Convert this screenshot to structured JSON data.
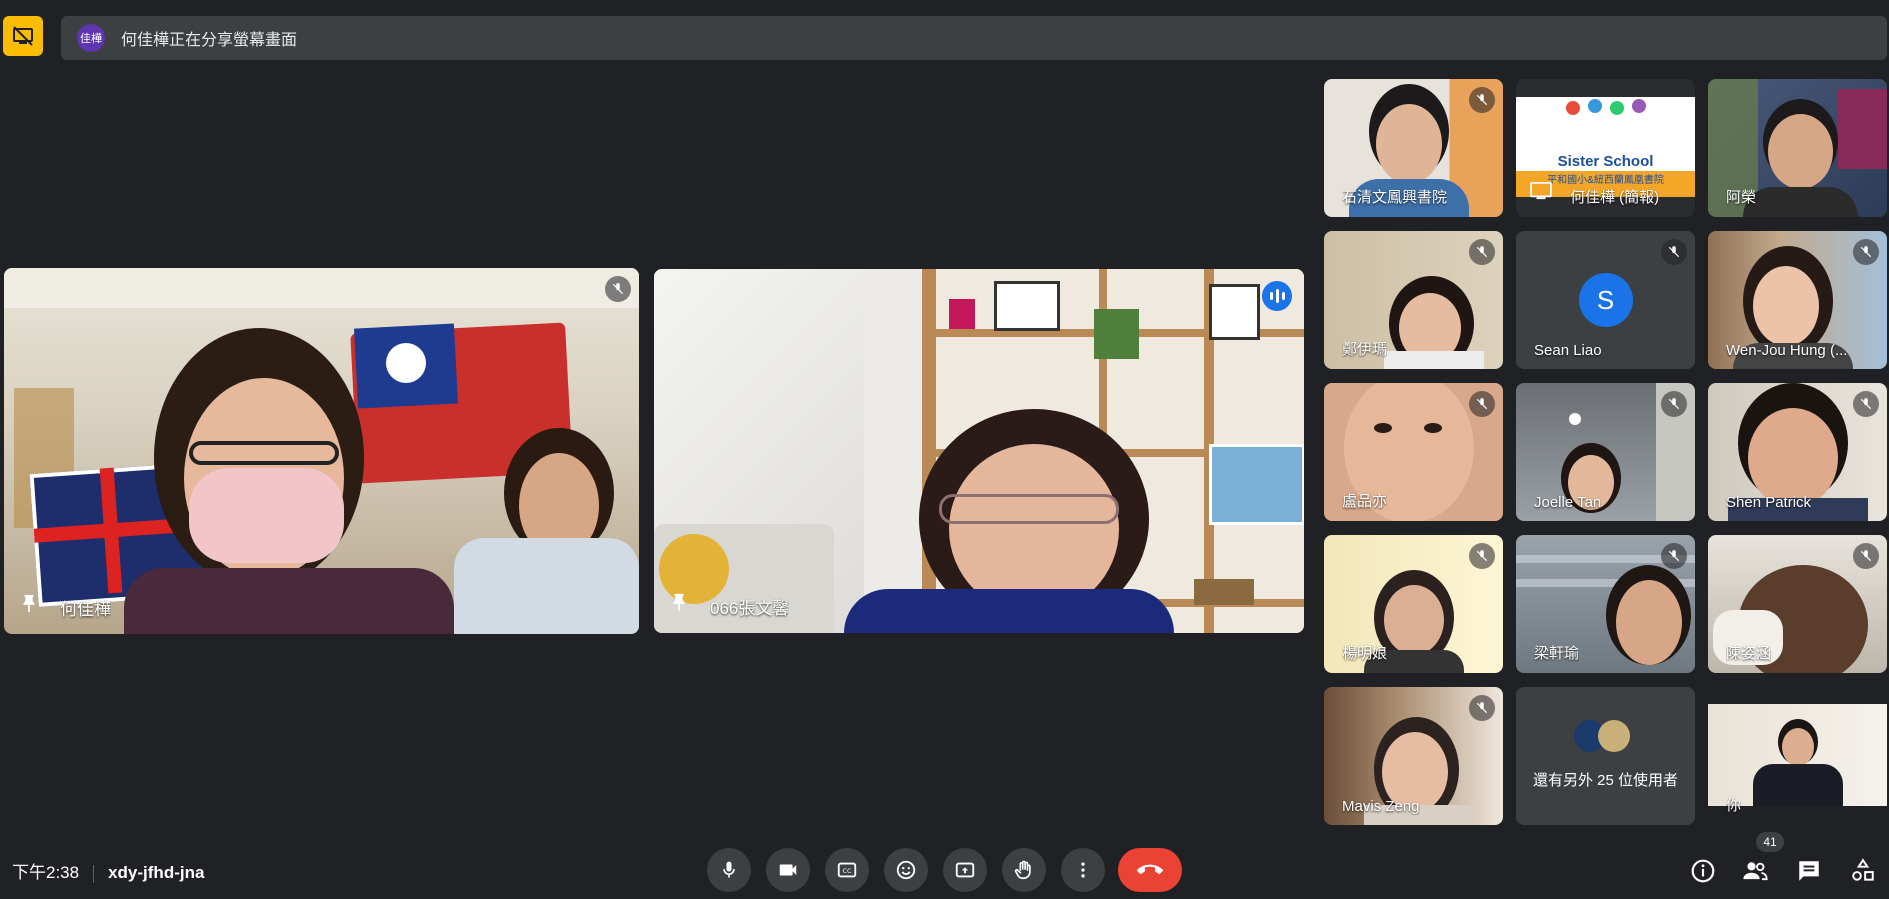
{
  "banner": {
    "avatar_label": "佳樺",
    "text": "何佳樺正在分享螢幕畫面"
  },
  "main_tiles": [
    {
      "name": "何佳樺"
    },
    {
      "name": "066張文馨"
    }
  ],
  "grid": [
    {
      "name": "石清文鳳興書院"
    },
    {
      "name": "何佳樺 (簡報)",
      "slide_title": "Sister School",
      "slide_sub": "平和國小&紐西蘭鳳凰書院"
    },
    {
      "name": "阿榮"
    },
    {
      "name": "鄭伊瑪"
    },
    {
      "name": "Sean Liao",
      "avatar_letter": "S"
    },
    {
      "name": "Wen-Jou Hung (..."
    },
    {
      "name": "盧品亦"
    },
    {
      "name": "Joelle Tan"
    },
    {
      "name": "Shen Patrick"
    },
    {
      "name": "楊明娘"
    },
    {
      "name": "梁軒瑜"
    },
    {
      "name": "陳姿涵"
    },
    {
      "name": "Mavis Zeng"
    },
    {
      "name": "還有另外 25 位使用者"
    },
    {
      "name": "你"
    }
  ],
  "bottom": {
    "time": "下午2:38",
    "meeting_code": "xdy-jfhd-jna",
    "participant_count": "41"
  },
  "colors": {
    "accent": "#1a73e8",
    "end_call": "#ea4335",
    "present": "#fbbc04",
    "bg": "#202124"
  }
}
